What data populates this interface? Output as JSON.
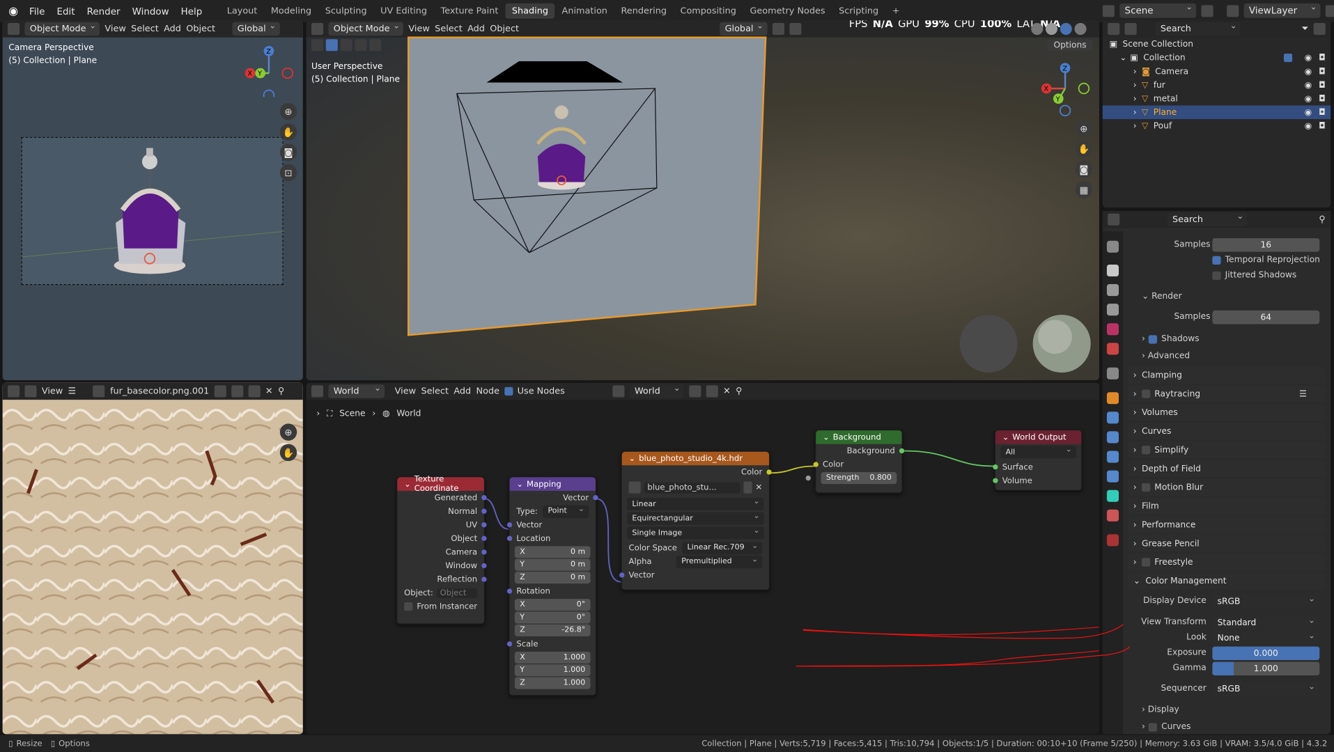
{
  "menu": [
    "File",
    "Edit",
    "Render",
    "Window",
    "Help"
  ],
  "workspaces": [
    "Layout",
    "Modeling",
    "Sculpting",
    "UV Editing",
    "Texture Paint",
    "Shading",
    "Animation",
    "Rendering",
    "Compositing",
    "Geometry Nodes",
    "Scripting"
  ],
  "active_workspace": "Shading",
  "scene": "Scene",
  "view_layer": "ViewLayer",
  "left_vp": {
    "mode": "Object Mode",
    "view": "View",
    "select": "Select",
    "add": "Add",
    "object": "Object",
    "orient": "Global",
    "title": "Camera Perspective",
    "sub": "(5) Collection | Plane"
  },
  "main_vp": {
    "mode": "Object Mode",
    "view": "View",
    "select": "Select",
    "add": "Add",
    "object": "Object",
    "orient": "Global",
    "title": "User Perspective",
    "sub": "(5) Collection | Plane",
    "options": "Options",
    "fps": "FPS",
    "fps_val": "N/A",
    "gpu": "GPU",
    "gpu_val": "99%",
    "cpu": "CPU",
    "cpu_val": "100%",
    "lat": "LAT",
    "lat_val": "N/A"
  },
  "img_editor": {
    "view": "View",
    "image": "fur_basecolor.png.001"
  },
  "node_editor": {
    "type": "World",
    "view": "View",
    "select": "Select",
    "add": "Add",
    "node": "Node",
    "use_nodes": "Use Nodes",
    "world": "World",
    "crumb1": "Scene",
    "crumb2": "World"
  },
  "nodes": {
    "texcoord": {
      "title": "Texture Coordinate",
      "outputs": [
        "Generated",
        "Normal",
        "UV",
        "Object",
        "Camera",
        "Window",
        "Reflection"
      ],
      "object_label": "Object:",
      "object_ph": "Object",
      "from_instancer": "From Instancer"
    },
    "mapping": {
      "title": "Mapping",
      "out": "Vector",
      "type_label": "Type:",
      "type": "Point",
      "vector": "Vector",
      "location": "Location",
      "loc": [
        "0 m",
        "0 m",
        "0 m"
      ],
      "rotation": "Rotation",
      "rot": [
        "0°",
        "0°",
        "-26.8°"
      ],
      "scale": "Scale",
      "scl": [
        "1.000",
        "1.000",
        "1.000"
      ],
      "axes": [
        "X",
        "Y",
        "Z"
      ]
    },
    "envtex": {
      "title": "blue_photo_studio_4k.hdr",
      "out": "Color",
      "image": "blue_photo_stu...",
      "interp": "Linear",
      "proj": "Equirectangular",
      "src": "Single Image",
      "cs_label": "Color Space",
      "cs": "Linear Rec.709",
      "alpha_label": "Alpha",
      "alpha": "Premultiplied",
      "vector": "Vector"
    },
    "background": {
      "title": "Background",
      "out": "Background",
      "color": "Color",
      "strength_label": "Strength",
      "strength": "0.800"
    },
    "output": {
      "title": "World Output",
      "target": "All",
      "surface": "Surface",
      "volume": "Volume"
    }
  },
  "outliner": {
    "search": "Search",
    "scene_collection": "Scene Collection",
    "collection": "Collection",
    "items": [
      "Camera",
      "fur",
      "metal",
      "Plane",
      "Pouf"
    ]
  },
  "props": {
    "search": "Search",
    "samples_label": "Samples",
    "samples1": "16",
    "temporal": "Temporal Reprojection",
    "jittered": "Jittered Shadows",
    "render": "Render",
    "samples2": "64",
    "shadows": "Shadows",
    "advanced": "Advanced",
    "sections": [
      "Clamping",
      "Raytracing",
      "Volumes",
      "Curves",
      "Simplify",
      "Depth of Field",
      "Motion Blur",
      "Film",
      "Performance",
      "Grease Pencil",
      "Freestyle",
      "Color Management"
    ],
    "display_device_label": "Display Device",
    "display_device": "sRGB",
    "view_transform_label": "View Transform",
    "view_transform": "Standard",
    "look_label": "Look",
    "look": "None",
    "exposure_label": "Exposure",
    "exposure": "0.000",
    "gamma_label": "Gamma",
    "gamma": "1.000",
    "sequencer_label": "Sequencer",
    "sequencer": "sRGB",
    "display": "Display",
    "curves": "Curves"
  },
  "status": {
    "resize": "Resize",
    "options": "Options",
    "info": "Collection | Plane | Verts:5,719 | Faces:5,415 | Tris:10,794 | Objects:1/5 | Duration: 00:10+10 (Frame 5/250) | Memory: 3.63 GiB | VRAM: 3.5/4.0 GiB | 4.3.2"
  },
  "colors": {
    "accent": "#4772b3",
    "texcoord": "#9b2a35",
    "mapping": "#5a3f8f",
    "envtex": "#a8581c",
    "background": "#2f6b2c",
    "output": "#6a2230"
  }
}
